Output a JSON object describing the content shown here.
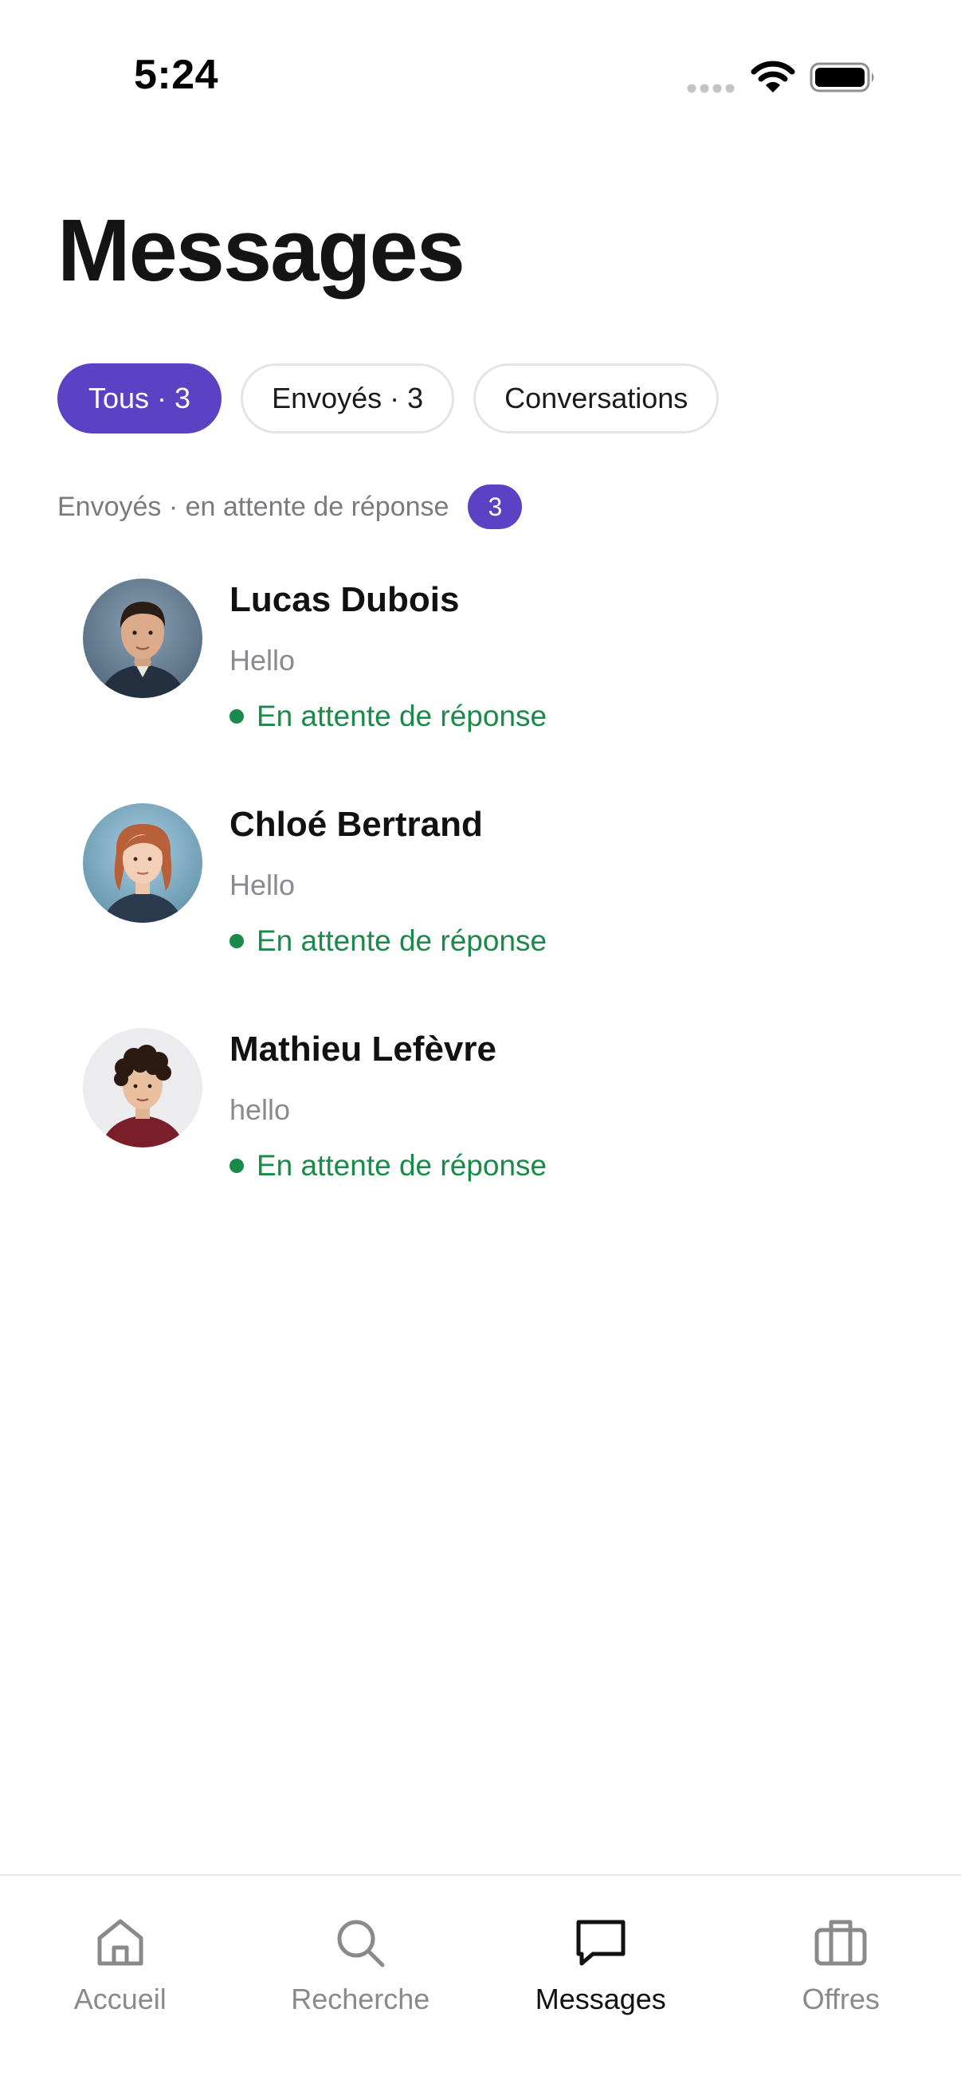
{
  "status_bar": {
    "time": "5:24",
    "icons": [
      "cellular-signal-icon",
      "wifi-icon",
      "battery-icon"
    ]
  },
  "page": {
    "title": "Messages"
  },
  "filters": [
    {
      "label": "Tous · 3",
      "active": true
    },
    {
      "label": "Envoyés · 3",
      "active": false
    },
    {
      "label": "Conversations",
      "active": false
    }
  ],
  "section": {
    "label": "Envoyés · en attente de réponse",
    "count": "3"
  },
  "messages": [
    {
      "name": "Lucas Dubois",
      "preview": "Hello",
      "status": "En attente de réponse"
    },
    {
      "name": "Chloé Bertrand",
      "preview": "Hello",
      "status": "En attente de réponse"
    },
    {
      "name": "Mathieu Lefèvre",
      "preview": "hello",
      "status": "En attente de réponse"
    }
  ],
  "tab_bar": {
    "tabs": [
      {
        "label": "Accueil",
        "icon": "home-icon",
        "active": false
      },
      {
        "label": "Recherche",
        "icon": "search-icon",
        "active": false
      },
      {
        "label": "Messages",
        "icon": "message-icon",
        "active": true
      },
      {
        "label": "Offres",
        "icon": "briefcase-icon",
        "active": false
      }
    ]
  },
  "colors": {
    "accent": "#5b41c4",
    "status_green": "#1a8a4a",
    "muted_text": "#8a8a90"
  }
}
